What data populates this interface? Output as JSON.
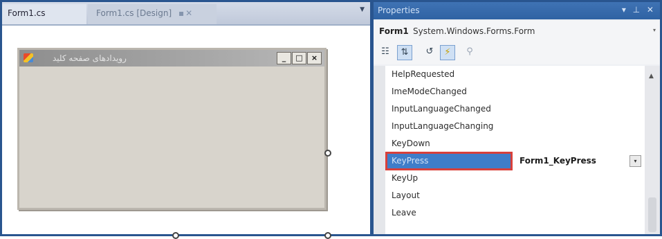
{
  "editor": {
    "tabs": [
      {
        "label": "Form1.cs",
        "active": true
      },
      {
        "label": "Form1.cs [Design]",
        "active": false,
        "icons": "▪✕"
      }
    ],
    "tab_dropdown_icon": "chevron-down-icon",
    "tab_dropdown_glyph": "▼"
  },
  "form_window": {
    "title": "رویدادهای صفحه کلید",
    "icon": "application-icon",
    "controls": {
      "minimize": "_",
      "maximize": "□",
      "close": "×"
    }
  },
  "properties": {
    "header_title": "Properties",
    "header_icons": "▾ ⊥ ✕",
    "object_name": "Form1",
    "object_type": "System.Windows.Forms.Form",
    "object_dropdown_glyph": "▾",
    "toolbar": {
      "categorized_glyph": "☷",
      "alphabetical_glyph": "⇅",
      "properties_glyph": "↺",
      "events_glyph": "⚡",
      "property_pages_glyph": "⚲"
    },
    "events": [
      {
        "name": "HelpRequested",
        "value": ""
      },
      {
        "name": "ImeModeChanged",
        "value": ""
      },
      {
        "name": "InputLanguageChanged",
        "value": ""
      },
      {
        "name": "InputLanguageChanging",
        "value": ""
      },
      {
        "name": "KeyDown",
        "value": ""
      },
      {
        "name": "KeyPress",
        "value": "Form1_KeyPress",
        "selected": true,
        "highlight_color": "#d8403b"
      },
      {
        "name": "KeyUp",
        "value": ""
      },
      {
        "name": "Layout",
        "value": ""
      },
      {
        "name": "Leave",
        "value": ""
      }
    ],
    "value_dropdown_glyph": "▾",
    "scroll_up_glyph": "▲"
  },
  "colors": {
    "frame_blue": "#29558f",
    "selection_blue": "#3f7dc9",
    "highlight_red": "#d8403b"
  }
}
